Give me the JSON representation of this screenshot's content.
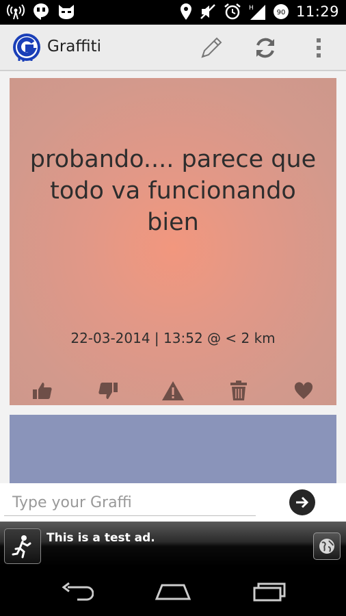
{
  "status_bar": {
    "time": "11:29",
    "battery_level": "90",
    "left_icons": [
      "wireless-tower-icon",
      "hangouts-icon",
      "cyanogen-cat-icon"
    ],
    "right_icons": [
      "location-icon",
      "mute-icon",
      "alarm-icon",
      "signal-icon",
      "battery-icon"
    ]
  },
  "action_bar": {
    "title": "Graffiti",
    "actions": [
      "pencil-icon",
      "refresh-icon",
      "overflow-menu-icon"
    ]
  },
  "graffiti_card": {
    "message": "probando.... parece que todo va funcionando bien",
    "meta": "22-03-2014 | 13:52 @ < 2 km",
    "actions": [
      "thumbs-up-icon",
      "thumbs-down-icon",
      "warning-icon",
      "trash-icon",
      "heart-icon"
    ],
    "background_color": "#e29887"
  },
  "next_card": {
    "background_color": "#8a94ba"
  },
  "compose": {
    "value": "",
    "placeholder": "Type your Graffi"
  },
  "ad": {
    "text": "This is a test ad."
  }
}
